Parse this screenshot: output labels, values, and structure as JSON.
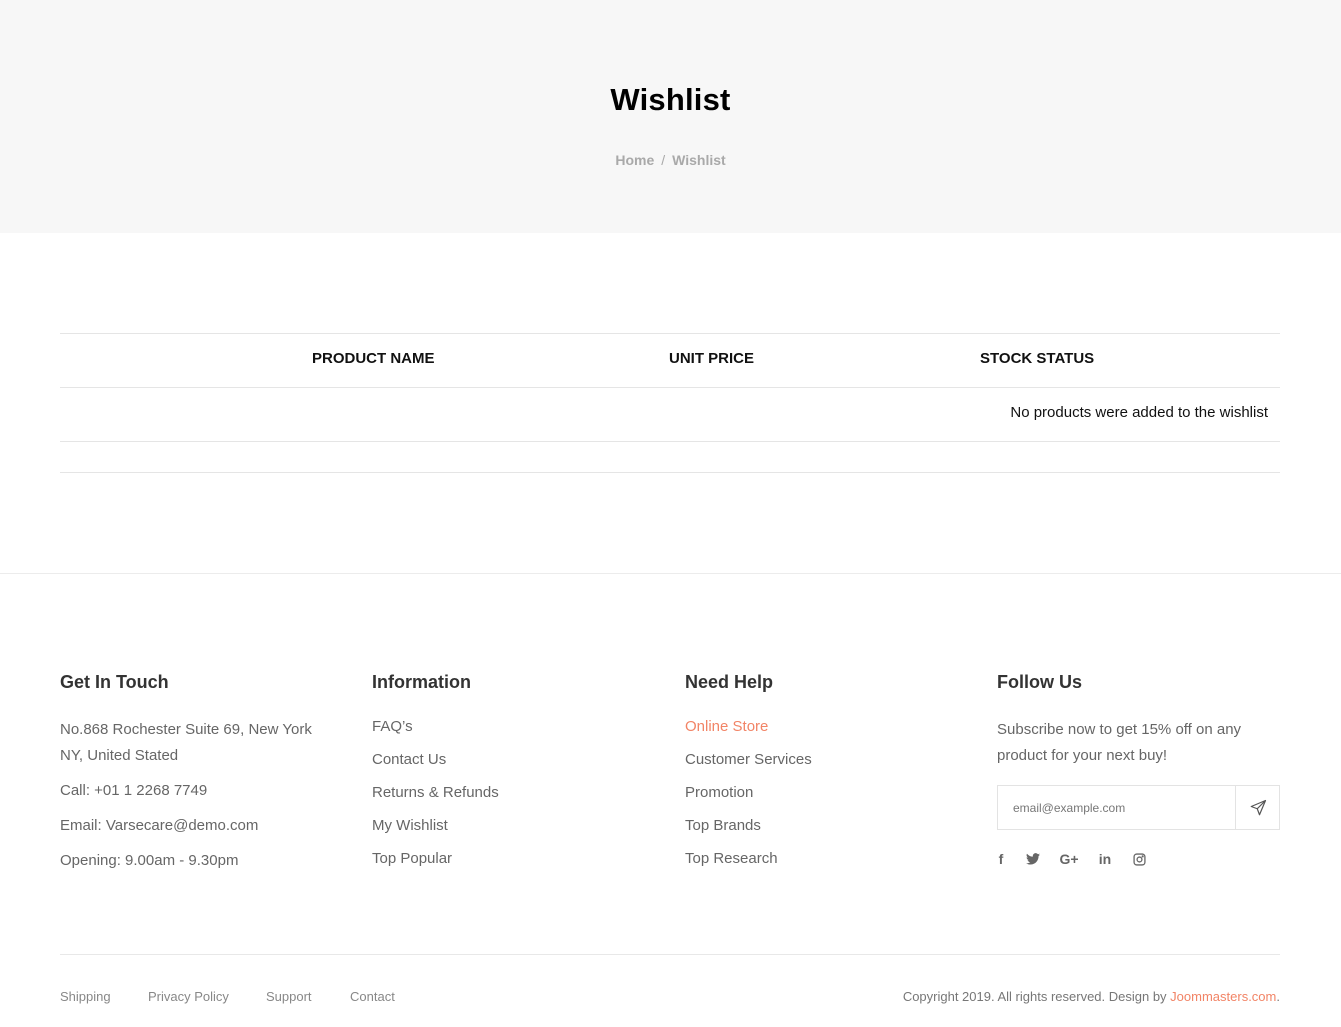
{
  "hero": {
    "title": "Wishlist",
    "breadcrumb": {
      "home": "Home",
      "separator": "/",
      "current": "Wishlist"
    }
  },
  "wishlist": {
    "columns": [
      "PRODUCT NAME",
      "UNIT PRICE",
      "STOCK STATUS"
    ],
    "empty_message": "No products were added to the wishlist"
  },
  "footer": {
    "get_in_touch": {
      "title": "Get In Touch",
      "address_line1": "No.868 Rochester Suite 69, New York",
      "address_line2": "NY, United Stated",
      "call": "Call: +01 1 2268 7749",
      "email": "Email: Varsecare@demo.com",
      "opening": "Opening: 9.00am - 9.30pm"
    },
    "information": {
      "title": "Information",
      "links": [
        "FAQ’s",
        "Contact Us",
        "Returns & Refunds",
        "My Wishlist",
        "Top Popular"
      ]
    },
    "need_help": {
      "title": "Need Help",
      "links": [
        "Online Store",
        "Customer Services",
        "Promotion",
        "Top Brands",
        "Top Research"
      ]
    },
    "follow_us": {
      "title": "Follow Us",
      "text": "Subscribe now to get 15% off on any product for your next buy!",
      "email_placeholder": "email@example.com",
      "social": [
        "facebook-icon",
        "twitter-icon",
        "google-plus-icon",
        "linkedin-icon",
        "instagram-icon"
      ]
    },
    "bottom_links": [
      "Shipping",
      "Privacy Policy",
      "Support",
      "Contact"
    ],
    "copyright": {
      "text": "Copyright 2019. All rights reserved. Design by ",
      "brand": "Joommasters.com",
      "end": "."
    }
  },
  "colors": {
    "accent": "#f28466",
    "hero_bg": "#f7f7f7",
    "text_muted": "#666666"
  }
}
